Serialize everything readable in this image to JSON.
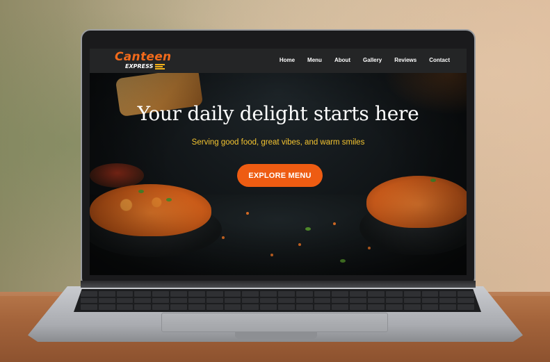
{
  "browser_page": {
    "brand": {
      "name": "Canteen",
      "tagline": "EXPRESS"
    },
    "nav": {
      "items": [
        {
          "label": "Home"
        },
        {
          "label": "Menu"
        },
        {
          "label": "About"
        },
        {
          "label": "Gallery"
        },
        {
          "label": "Reviews"
        },
        {
          "label": "Contact"
        }
      ]
    },
    "hero": {
      "title": "Your daily delight starts here",
      "subtitle": "Serving good food, great vibes, and warm smiles",
      "cta_label": "EXPLORE MENU"
    },
    "colors": {
      "brand_orange": "#f26a1b",
      "accent_yellow": "#f4c430",
      "cta_background": "#ee5c12",
      "navbar_background": "#242526"
    }
  }
}
